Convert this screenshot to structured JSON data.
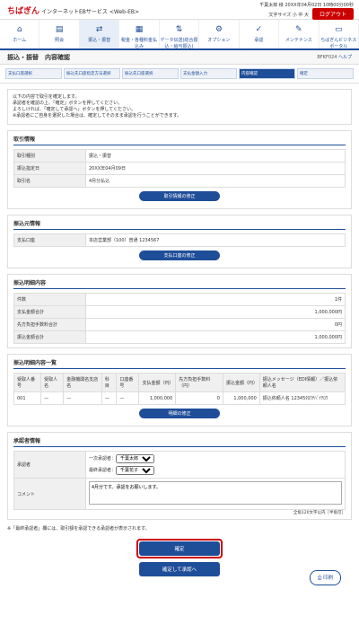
{
  "header": {
    "logo": "ちばぎん",
    "service": "インターネットEBサービス <Web-EB>",
    "user": "千葉太郎 様",
    "datetime": "20XX年04月02日 10時00分00秒",
    "fontsize": "文字サイズ 小 中 大",
    "logout": "ログアウト"
  },
  "nav": [
    "ホーム",
    "照会",
    "振込・振替",
    "税金・各種料金払込み",
    "データ伝送(総合振込・給与振込)",
    "オプション",
    "承認",
    "メンテナンス",
    "ちばぎんビジネスポータル"
  ],
  "title": {
    "label": "振込・振替　内容確認",
    "code": "BFKF024",
    "help": "ヘルプ"
  },
  "steps": [
    "支払口座選択",
    "振込先口座指定方法選択",
    "振込先口座選択",
    "支払金額入力",
    "内容確認",
    "確定"
  ],
  "note": [
    "以下の内容で取引を確定します。",
    "承認者を確認の上、「確定」ボタンを押してください。",
    "よろしければ、「確定して承認へ」ボタンを押してください。",
    "※承認者にご自身を選択した場合は、確定してそのまま承認を行うことができます。"
  ],
  "tx": {
    "title": "取引情報",
    "rows": [
      [
        "取引種別",
        "振込・振替"
      ],
      [
        "振込指定日",
        "20XX年04月09日"
      ],
      [
        "取引名",
        "4月分払込"
      ]
    ],
    "btn": "取引情報の修正"
  },
  "src": {
    "title": "振込元情報",
    "rows": [
      [
        "支払口座",
        "本店営業部（100）普通 1234567"
      ]
    ],
    "btn": "支払口座の修正"
  },
  "sum": {
    "title": "振込明細内容",
    "rows": [
      [
        "件数",
        "1件"
      ],
      [
        "支払金額合計",
        "1,000,000円"
      ],
      [
        "先方負担手数料合計",
        "0円"
      ],
      [
        "振込金額合計",
        "1,000,000円"
      ]
    ]
  },
  "list": {
    "title": "振込明細内容一覧",
    "heads": [
      "受取人番号",
      "受取人名",
      "金融機関名支店名",
      "科目",
      "口座番号",
      "支払金額（円）",
      "先方負担手数料（円）",
      "振込金額（円）",
      "振込メッセージ（EDI情報）／振込依頼人名"
    ],
    "row": [
      "001",
      "—",
      "—",
      "—",
      "—",
      "1,000,000",
      "0",
      "1,000,000",
      "振込依頼人名 12345ﾀﾛｳﾁﾊﾞｲﾁﾛｳ"
    ],
    "btn": "明細の修正"
  },
  "app": {
    "title": "承認者情報",
    "label": "承認者",
    "first": "一次承認者：",
    "firstVal": "千葉太郎",
    "final": "最終承認者：",
    "finalVal": "千葉花子",
    "commentLabel": "コメント",
    "comment": "4月分です。承認をお願いします。",
    "limit": "全角120文字以内［半角可］"
  },
  "footnote": "※「最終承認者」欄には、取引額を承認できる承認者が表示されます。",
  "buttons": {
    "confirm": "確定",
    "confirmApprove": "確定して承認へ",
    "print": "印刷"
  }
}
